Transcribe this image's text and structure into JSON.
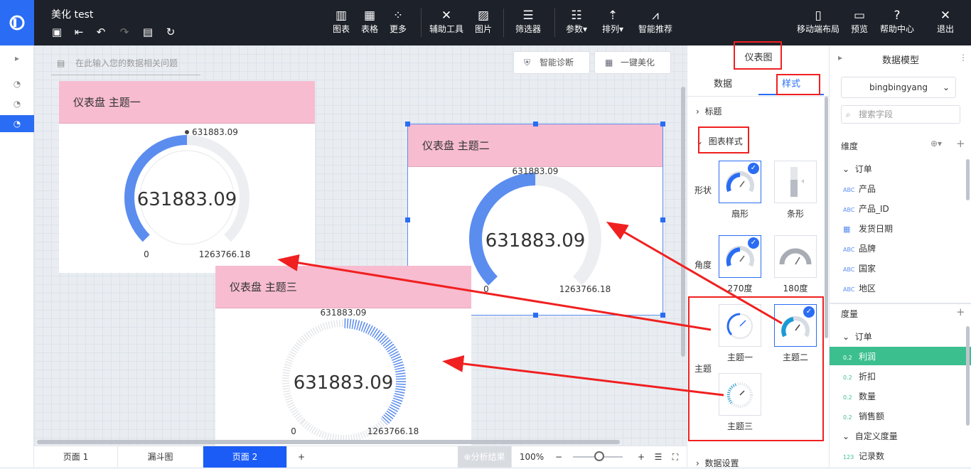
{
  "app": {
    "title": "美化 test"
  },
  "toolbar": {
    "chart": "图表",
    "table": "表格",
    "more": "更多",
    "assist": "辅助工具",
    "image": "图片",
    "filter": "筛选器",
    "params": "参数",
    "sort": "排列",
    "smart": "智能推荐",
    "mobile": "移动端布局",
    "preview": "预览",
    "help": "帮助中心",
    "exit": "退出"
  },
  "canvas": {
    "question_placeholder": "在此输入您的数据相关问题",
    "diagnose": "智能诊断",
    "beautify": "一键美化"
  },
  "gauges": [
    {
      "title": "仪表盘 主题一",
      "value": "631883.09",
      "min": "0",
      "max": "1263766.18",
      "ratio": 0.5
    },
    {
      "title": "仪表盘 主题二",
      "value": "631883.09",
      "min": "0",
      "max": "1263766.18",
      "ratio": 0.5
    },
    {
      "title": "仪表盘 主题三",
      "value": "631883.09",
      "min": "0",
      "max": "1263766.18",
      "ratio": 0.5
    }
  ],
  "style_panel": {
    "header": "仪表图",
    "tab_data": "数据",
    "tab_style": "样式",
    "section_title": "标题",
    "section_chart_style": "图表样式",
    "shape_label": "形状",
    "shape_fan": "扇形",
    "shape_bar": "条形",
    "angle_label": "角度",
    "angle_270": "270度",
    "angle_180": "180度",
    "theme_label": "主题",
    "theme1": "主题一",
    "theme2": "主题二",
    "theme3": "主题三",
    "section_data_settings": "数据设置"
  },
  "model": {
    "header": "数据模型",
    "source": "bingbingyang",
    "search_placeholder": "搜索字段",
    "dimensions": "维度",
    "dim_group": "订单",
    "dim_fields": [
      {
        "type": "ABC",
        "name": "产品"
      },
      {
        "type": "ABC",
        "name": "产品_ID"
      },
      {
        "type": "date",
        "name": "发货日期"
      },
      {
        "type": "ABC",
        "name": "品牌"
      },
      {
        "type": "ABC",
        "name": "国家"
      },
      {
        "type": "ABC",
        "name": "地区"
      }
    ],
    "measures": "度量",
    "measure_group": "订单",
    "measure_fields": [
      {
        "type": "0.2",
        "name": "利润"
      },
      {
        "type": "0.2",
        "name": "折扣"
      },
      {
        "type": "0.2",
        "name": "数量"
      },
      {
        "type": "0.2",
        "name": "销售额"
      }
    ],
    "custom_group": "自定义度量",
    "custom_fields": [
      {
        "type": "123",
        "name": "记录数"
      }
    ]
  },
  "bottom": {
    "pages": [
      "页面 1",
      "漏斗图",
      "页面 2"
    ],
    "add": "+",
    "analysis": "分析结果",
    "zoom": "100%"
  },
  "colors": {
    "accent": "#2a6df4",
    "pink": "#f7bcd0",
    "gauge_blue": "#5b8def",
    "red": "#f02020",
    "green": "#3cbf8f"
  }
}
